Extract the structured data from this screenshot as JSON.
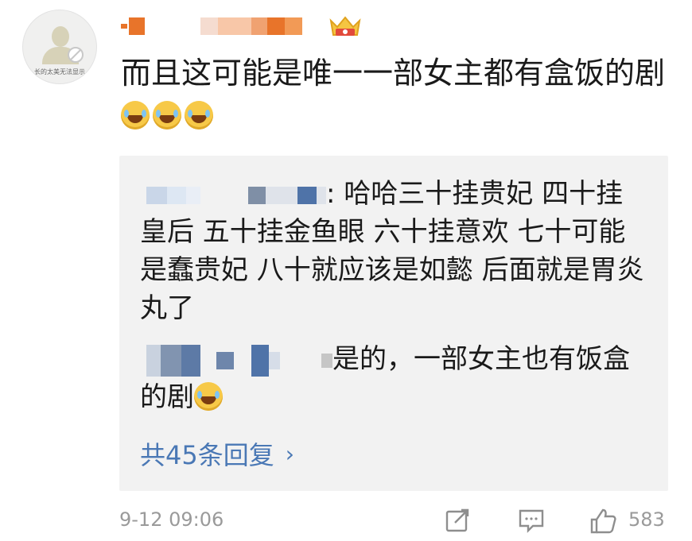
{
  "user": {
    "avatar_caption": "长的太美无法显示",
    "username_blocks": [
      "#e8742a",
      "#ffffff",
      "#ffffff",
      "#f5dcd0",
      "#f8c7a8",
      "#f0a271",
      "#e8742a",
      "#f29a56"
    ]
  },
  "comment": {
    "text_line": "而且这可能是唯一一部女主都有盒饭的剧",
    "emoji": [
      "laugh-cry-emoji",
      "laugh-cry-emoji",
      "laugh-cry-emoji"
    ]
  },
  "replies": [
    {
      "text": ": 哈哈三十挂贵妃 四十挂皇后 五十挂金鱼眼 六十挂意欢 七十可能是蠢贵妃 八十就应该是如懿 后面就是胃炎丸了"
    },
    {
      "text": "是的，一部女主也有饭盒的剧"
    }
  ],
  "more_replies": "共45条回复",
  "footer": {
    "timestamp": "9-12 09:06",
    "like_count": "583"
  },
  "colors": {
    "link": "#4a78b5",
    "reply_bg": "#f2f2f2",
    "meta": "#9a9a9a"
  }
}
